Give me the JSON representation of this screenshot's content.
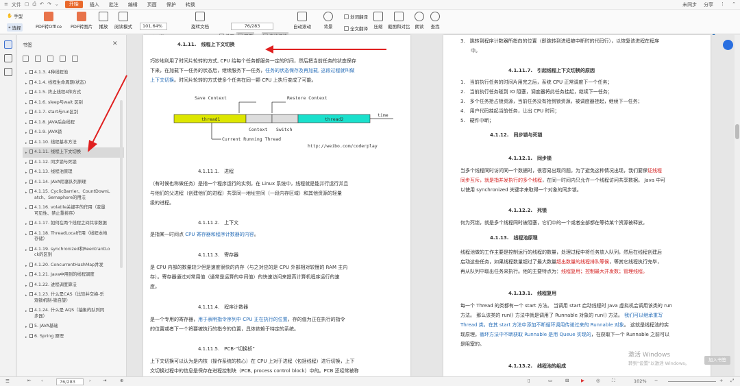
{
  "menubar": {
    "items": [
      "文件",
      "插入",
      "批注",
      "编辑",
      "页面",
      "保护",
      "转换"
    ],
    "active": "开始",
    "right": [
      "未同步",
      "分享"
    ]
  },
  "toolbar": {
    "hand": "手型",
    "select": "选择",
    "pdf_office": "PDF转Office",
    "pdf_image": "PDF转图片",
    "play": "播放",
    "read_mode": "阅读模式",
    "zoom": "101.64%",
    "rotate": "旋转文档",
    "single": "单页",
    "double": "双页",
    "continuous": "连续阅读",
    "auto_scroll": "自动滚动",
    "background": "背景",
    "translate": "划词翻译",
    "full_translate": "全文翻译",
    "compress": "压缩",
    "screenshot": "截图和对比",
    "read": "朗读",
    "find": "查找",
    "page_value": "76/283"
  },
  "sidebar": {
    "title": "书签",
    "items": [
      {
        "label": "4.1.3. 4种线程池",
        "selected": false
      },
      {
        "label": "4.1.4. 线程生命周期(状态)",
        "selected": false
      },
      {
        "label": "4.1.5. 终止线程4种方式",
        "selected": false
      },
      {
        "label": "4.1.6. sleep与wait 区别",
        "selected": false
      },
      {
        "label": "4.1.7. start与run区别",
        "selected": false
      },
      {
        "label": "4.1.8. JAVA后台线程",
        "selected": false
      },
      {
        "label": "4.1.9. JAVA锁",
        "selected": false
      },
      {
        "label": "4.1.10. 线程基本方法",
        "selected": false
      },
      {
        "label": "4.1.11. 线程上下文切换",
        "selected": true
      },
      {
        "label": "4.1.12. 同步锁与死锁",
        "selected": false
      },
      {
        "label": "4.1.13. 线程池原理",
        "selected": false
      },
      {
        "label": "4.1.14. JAVA阻塞队列原理",
        "selected": false
      },
      {
        "label": "4.1.15. CyclicBarrier、CountDownL\natch、Semaphore的用法",
        "selected": false
      },
      {
        "label": "4.1.16. volatile关键字的作用（变量\n可见性、禁止重排序）",
        "selected": false
      },
      {
        "label": "4.1.17. 如何在两个线程之间共享数据",
        "selected": false
      },
      {
        "label": "4.1.18. ThreadLocal作用（线程本地\n存储）",
        "selected": false
      },
      {
        "label": "4.1.19. synchronized和ReentrantLo\nck的区别",
        "selected": false
      },
      {
        "label": "4.1.20. ConcurrentHashMap并发",
        "selected": false
      },
      {
        "label": "4.1.21. Java中用到的线程调度",
        "selected": false
      },
      {
        "label": "4.1.22. 进程调度算法",
        "selected": false
      },
      {
        "label": "4.1.23. 什么是CAS（比较并交换-乐\n观锁机制-锁自旋）",
        "selected": false
      },
      {
        "label": "4.1.24. 什么是 AQS（抽象的队列同\n步器）",
        "selected": false
      },
      {
        "label": "5. JAVA基础",
        "selected": false
      },
      {
        "label": "6. Spring 原理",
        "selected": false
      }
    ]
  },
  "page1": {
    "h1": "4.1.11.　线程上下文切换",
    "p1a": "巧妙地利用了时间片轮转的方式, CPU 给每个任务都服务一定的时间，然后把当前任务的状态保存",
    "p1b": "下来，在加载下一任务的状态后，继续服务下一任务，",
    "p1c": "任务的状态保存及再加载, 这段过程就叫做",
    "p1d": "上下文切换",
    "p1e": "。时间片轮转的方式使多个任务在同一颗 CPU 上执行变成了可能。",
    "diagram": {
      "save": "Save Context",
      "restore": "Restore Context",
      "thread1": "thread1",
      "thread2": "thread2",
      "time": "time",
      "context": "Context",
      "switch": "Switch",
      "running": "Current Running Thread",
      "url": "http://weibo.com/coderplay"
    },
    "h2": "4.1.11.1.　进程",
    "p2a": "（有时候也称做任务）是指一个程序运行的实例。在 Linux 系统中，线程就是能并行运行并且",
    "p2b": "与他们的父进程（创建他们的进程）共享同一地址空间（一段内存区域）和其他资源的轻量",
    "p2c": "级的进程。",
    "h3": "4.1.11.2.　上下文",
    "p3a": "是指某一时间点 ",
    "p3b": "CPU 寄存器和程序计数器的内容",
    "p3c": "。",
    "h4": "4.1.11.3.　寄存器",
    "p4a": "是 CPU 内部的数量较少但是速度很快的内存（与之对应的是 CPU 外部相对较慢的 RAM 主内",
    "p4b": "存）。寄存器通过对常用值（通常是运算的中间值）的快速访问来提高计算机程序运行的速",
    "p4c": "度。",
    "h5": "4.1.11.4.　程序计数器",
    "p5a": "是一个专用的寄存器，",
    "p5b": "用于表明指令序列中 CPU 正在执行的位置",
    "p5c": "，存的值为正在执行的指令",
    "p5d": "的位置或者下一个将要被执行的指令的位置，具体依赖于特定的系统。",
    "h6": "4.1.11.5.　PCB-“切换桢”",
    "p6a": "上下文切换可以认为是内核（操作系统的核心）在 CPU 上对于进程（包括线程）进行切换，上下",
    "p6b": "文切换过程中的信息是保存在进程控制块（PCB, process control block）中的。PCB 还经常被称"
  },
  "page2": {
    "t1a": "3.　跳转到程序计数器所指向的位置（即跳转到进程被中断时的代码行），以恢复该进程在程序",
    "t1b": "中。",
    "h1": "4.1.11.7.　引起线程上下文切换的原因",
    "l1": "1.　当前执行任务的时间片用完之后，系统 CPU 正常调度下一个任务；",
    "l2": "2.　当前执行任务碰到 IO 阻塞，调度器将此任务挂起，继续下一任务；",
    "l3": "3.　多个任务抢占锁资源，当前任务没有抢到锁资源，被调度器挂起，继续下一任务；",
    "l4": "4.　用户代码挂起当前任务，让出 CPU 时间；",
    "l5": "5.　硬件中断；",
    "h2": "4.1.12.　同步锁与死锁",
    "h3": "4.1.12.1.　同步锁",
    "p3a": "当多个线程同时访问同一个数据时，很容易出现问题。为了避免这种情况出现，我们要保",
    "p3b": "证线程",
    "p3c": "同步互斥，就是指并发执行的多个线程",
    "p3d": "，在同一时间内只允许一个线程访问共享数据。 Java 中可",
    "p3e": "以使用 synchronized 关键字来取得一个对象的同步锁。",
    "h4": "4.1.12.2.　死锁",
    "p4": "何为死锁，就是多个线程同时被阻塞，它们中的一个或者全部都在等待某个资源被释放。",
    "h5": "4.1.13.　线程池原理",
    "p5a": "线程池做的工作主要是控制运行的线程的数量，处理过程中将任务放入队列，然后在线程创建后",
    "p5b": "启动这些任务，如果线程数量超过了最大数量",
    "p5c": "超出数量的线程排队等候",
    "p5d": "，等其它线程执行完毕，",
    "p5e": "再从队列中取出任务来执行。他的主要特点为：",
    "p5f": "线程复用；控制最大并发数；管理线程。",
    "h6": "4.1.13.1.　线程复用",
    "p6a": "每一个 Thread 的类都有一个 start 方法。 当调用 start 启动线程时 Java 虚拟机会调用该类的 run",
    "p6b": "方法。 那么该类的 run() 方法中就是调用了 Runnable 对象的 run() 方法。 ",
    "p6c": "我们可以继承重写",
    "p6d": "Thread 类，在其 start 方法中添加不断循环调用传递过来的 Runnable 对象",
    "p6e": "。 这就是线程池的实",
    "p6f": "现原理。",
    "p6g": "循环方法中不断获取 Runnable 是用 Queue 实现的",
    "p6h": "，在获取下一个 Runnable 之前可以",
    "p6i": "是阻塞的。",
    "h7": "4.1.13.2.　线程池的组成"
  },
  "overlay": {
    "watermark": "激活 Windows",
    "watermark_sub": "转到\"设置\"以激活 Windows。",
    "float_button": "加入书签"
  },
  "status": {
    "page": "76/283",
    "zoom": "102%"
  }
}
